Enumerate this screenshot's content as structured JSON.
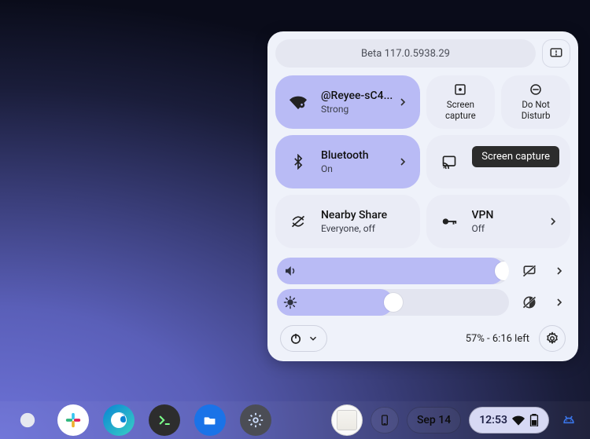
{
  "panel": {
    "beta_label": "Beta 117.0.5938.29",
    "tiles": {
      "wifi": {
        "label": "@Reyee-sC4...",
        "sub": "Strong"
      },
      "screencap": {
        "label": "Screen capture"
      },
      "dnd": {
        "label": "Do Not Disturb"
      },
      "bluetooth": {
        "label": "Bluetooth",
        "sub": "On"
      },
      "cast": {
        "label": "Cast screen"
      },
      "nearby": {
        "label": "Nearby Share",
        "sub": "Everyone, off"
      },
      "vpn": {
        "label": "VPN",
        "sub": "Off"
      }
    },
    "sliders": {
      "volume_pct": 98,
      "brightness_pct": 50
    },
    "battery_text": "57% - 6:16 left",
    "tooltip": "Screen capture"
  },
  "shelf": {
    "date": "Sep 14",
    "time": "12:53"
  }
}
